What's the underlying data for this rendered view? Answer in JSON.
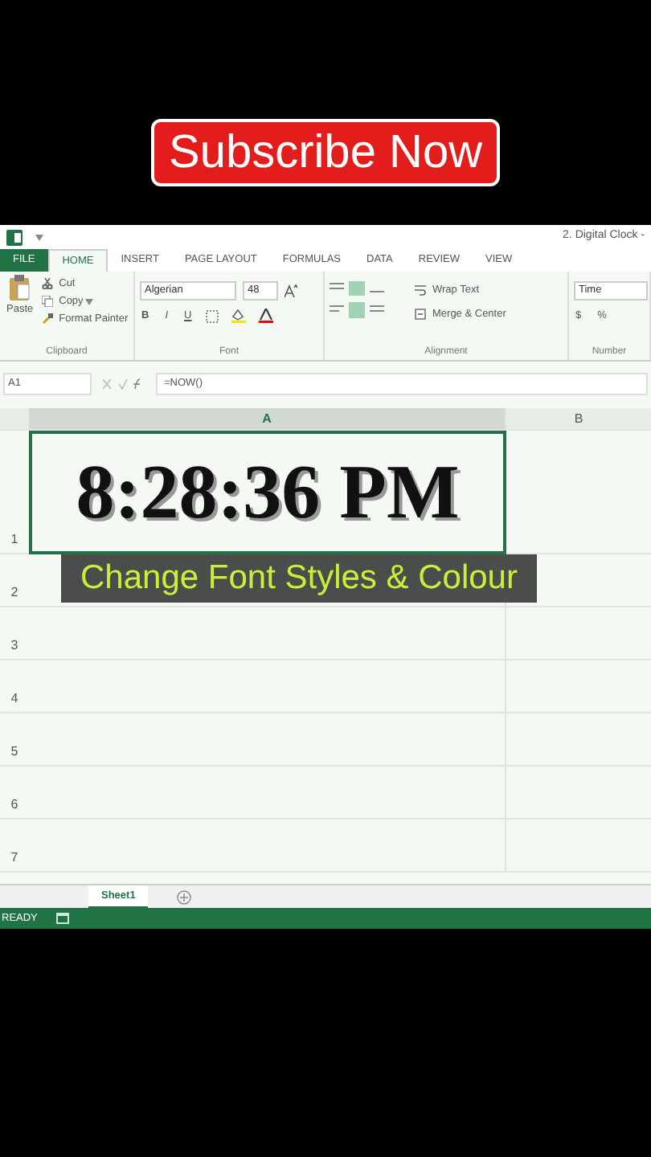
{
  "overlay": {
    "subscribe": "Subscribe Now",
    "caption": "Change Font Styles & Colour"
  },
  "title": "2. Digital Clock -",
  "tabs": [
    {
      "label": "FILE",
      "kind": "file",
      "selected": false
    },
    {
      "label": "HOME",
      "kind": "tab",
      "selected": true
    },
    {
      "label": "INSERT",
      "kind": "tab",
      "selected": false
    },
    {
      "label": "PAGE LAYOUT",
      "kind": "tab",
      "selected": false
    },
    {
      "label": "FORMULAS",
      "kind": "tab",
      "selected": false
    },
    {
      "label": "DATA",
      "kind": "tab",
      "selected": false
    },
    {
      "label": "REVIEW",
      "kind": "tab",
      "selected": false
    },
    {
      "label": "VIEW",
      "kind": "tab",
      "selected": false
    }
  ],
  "ribbon": {
    "clipboard": {
      "paste": "Paste",
      "cut": "Cut",
      "copy": "Copy",
      "painter": "Format Painter",
      "label": "Clipboard"
    },
    "font": {
      "name": "Algerian",
      "size": "48",
      "bold": "B",
      "italic": "I",
      "underline": "U",
      "label": "Font"
    },
    "alignment": {
      "wrap": "Wrap Text",
      "merge": "Merge & Center",
      "label": "Alignment"
    },
    "number": {
      "format": "Time",
      "currency": "$",
      "percent": "%",
      "label": "Number"
    }
  },
  "formula_bar": {
    "name_box": "A1",
    "formula": "=NOW()"
  },
  "columns": [
    "A",
    "B"
  ],
  "rows": [
    {
      "header": "1",
      "cell": "8:28:36 PM"
    },
    {
      "header": "2"
    },
    {
      "header": "3"
    },
    {
      "header": "4"
    },
    {
      "header": "5"
    },
    {
      "header": "6"
    },
    {
      "header": "7"
    }
  ],
  "sheet_tabs": [
    {
      "label": "Sheet1",
      "selected": true
    }
  ],
  "status": "READY"
}
